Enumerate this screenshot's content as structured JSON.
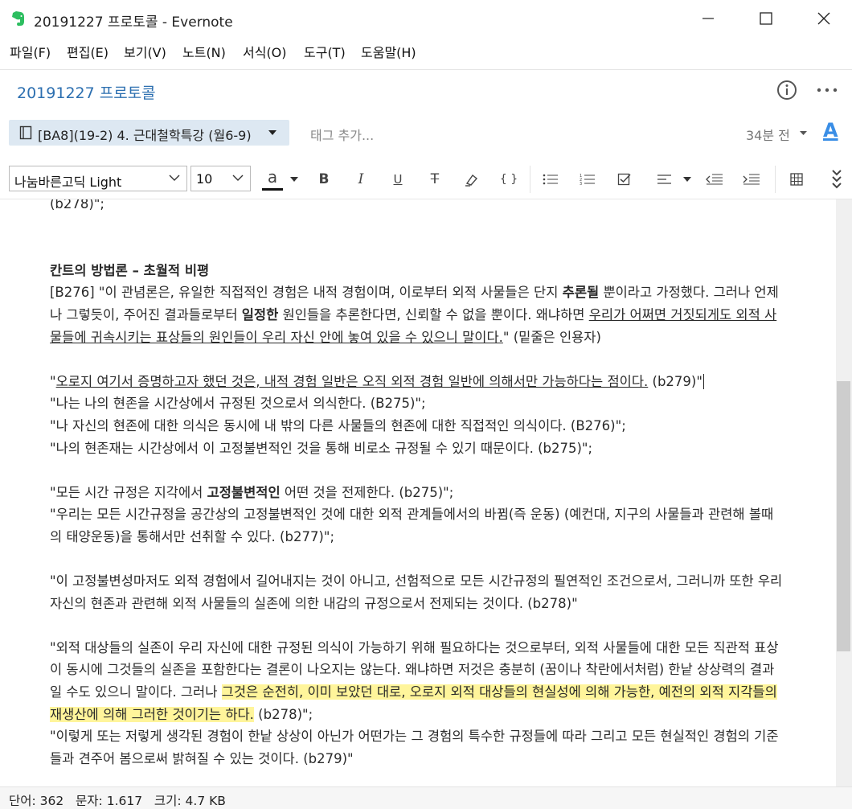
{
  "window": {
    "title": "20191227 프로토콜 - Evernote",
    "minimize_icon": "minimize-icon",
    "maximize_icon": "maximize-icon",
    "close_icon": "close-icon"
  },
  "menu": [
    "파일(F)",
    "편집(E)",
    "보기(V)",
    "노트(N)",
    "서식(O)",
    "도구(T)",
    "도움말(H)"
  ],
  "note": {
    "title": "20191227 프로토콜",
    "notebook": "[BA8](19-2) 4. 근대철학특강 (월6-9)",
    "tag_placeholder": "태그 추가...",
    "time_ago": "34분 전"
  },
  "toolbar": {
    "font": "나눔바른고딕 Light",
    "size": "10",
    "text_color_label": "a",
    "font_button_label": "A"
  },
  "content": {
    "l0": "(b278)\";",
    "heading": "칸트의 방법론 – 초월적 비평",
    "p1a": "[B276] \"이 관념론은, 유일한 직접적인 경험은 내적 경험이며, 이로부터 외적 사물들은 단지 ",
    "p1b": "추론될",
    "p1c": " 뿐이라고 가정했다. 그러나 언제나 그렇듯이, 주어진 결과들로부터 ",
    "p1d": "일정한",
    "p1e": " 원인들을 추론한다면, 신뢰할 수 없을 뿐이다. 왜냐하면 ",
    "p1f": "우리가 어쩌면 거짓되게도 외적 사물들에 귀속시키는 표상들의 원인들이 우리 자신 안에 놓여 있을 수 있으니 말이다.",
    "p1g": "\" (밑줄은 인용자)",
    "q1a": "\"",
    "q1b": "오로지 여기서 증명하고자 했던 것은, 내적 경험 일반은 오직 외적 경험 일반에 의해서만 가능하다는 점이다.",
    "q1c": " (b279)\"",
    "q2": "\"나는 나의 현존을 시간상에서 규정된 것으로서 의식한다. (B275)\";",
    "q3": "\"나 자신의 현존에 대한 의식은 동시에 내 밖의 다른 사물들의 현존에 대한 직접적인 의식이다. (B276)\";",
    "q4": "\"나의 현존재는 시간상에서 이 고정불변적인 것을 통해 비로소 규정될 수 있기 때문이다. (b275)\";",
    "q5a": "\"모든 시간 규정은 지각에서 ",
    "q5b": "고정불변적인",
    "q5c": " 어떤 것을 전제한다. (b275)\";",
    "q6": "\"우리는 모든 시간규정을 공간상의 고정불변적인 것에 대한 외적 관계들에서의 바뀜(즉 운동) (예컨대, 지구의 사물들과 관련해 볼때의 태양운동)을 통해서만 선취할 수 있다. (b277)\";",
    "q7": "\"이 고정불변성마저도 외적 경험에서 길어내지는 것이 아니고, 선험적으로 모든 시간규정의 필연적인 조건으로서, 그러니까 또한 우리 자신의 현존과 관련해 외적 사물들의 실존에 의한 내감의 규정으로서 전제되는 것이다. (b278)\"",
    "q8a": "\"외적 대상들의 실존이 우리 자신에 대한 규정된 의식이 가능하기 위해 필요하다는 것으로부터, 외적 사물들에 대한 모든 직관적 표상이 동시에 그것들의 실존을 포함한다는 결론이 나오지는 않는다. 왜냐하면 저것은 충분히 (꿈이나 착란에서처럼) 한낱 상상력의 결과일 수도 있으니 말이다. 그러나 ",
    "q8b": "그것은 순전히, 이미 보았던 대로, 오로지 외적 대상들의 현실성에 의해 가능한, 예전의 외적 지각들의 재생산에 의해 그러한 것이기는 하다.",
    "q8c": " (b278)\";",
    "q9": "\"이렇게 또는 저렇게 생각된 경험이 한낱 상상이 아닌가 어떤가는 그 경험의 특수한 규정들에 따라 그리고 모든 현실적인 경험의 기준들과 견주어 봄으로써 밝혀질 수 있는 것이다. (b279)\""
  },
  "status": "단어: 362   문자: 1.617   크기: 4.7 KB",
  "colors": {
    "accent": "#2c6fb0",
    "notebook_bg": "#dde8f2",
    "highlight": "#fff59b",
    "evernote_green": "#2dbe60"
  }
}
